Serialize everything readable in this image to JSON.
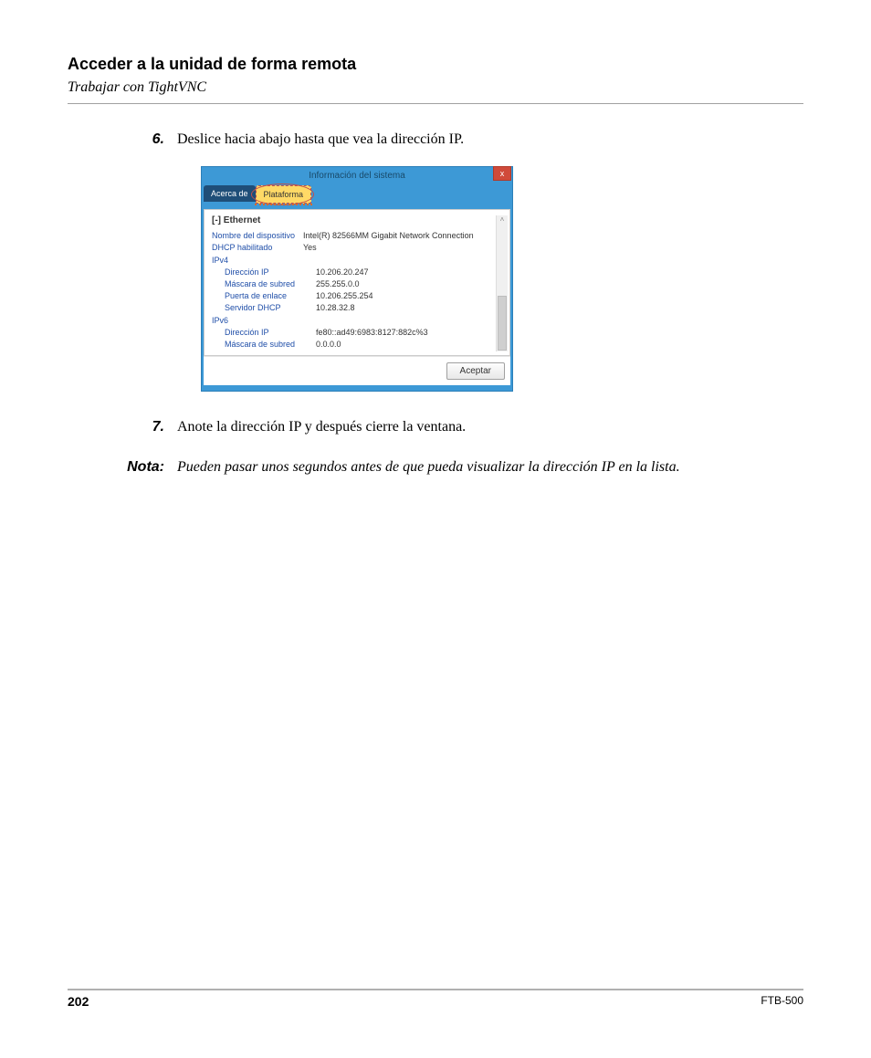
{
  "page": {
    "heading": "Acceder a la unidad de forma remota",
    "subheading": "Trabajar con TightVNC",
    "number": "202",
    "model": "FTB-500"
  },
  "steps": {
    "s6_num": "6.",
    "s6_text": "Deslice hacia abajo hasta que vea la dirección IP.",
    "s7_num": "7.",
    "s7_text": "Anote la dirección IP y después cierre la ventana."
  },
  "note": {
    "label": "Nota:",
    "text": "Pueden pasar unos segundos antes de que pueda visualizar la dirección IP en la lista."
  },
  "dialog": {
    "title": "Información del sistema",
    "close_glyph": "x",
    "tabs": {
      "about": "Acerca de",
      "platform": "Plataforma"
    },
    "section_header": "[-] Ethernet",
    "rows": {
      "device_name_k": "Nombre del dispositivo",
      "device_name_v": "Intel(R) 82566MM Gigabit Network Connection",
      "dhcp_enabled_k": "DHCP habilitado",
      "dhcp_enabled_v": "Yes",
      "ipv4": "IPv4",
      "ipv4_ip_k": "Dirección IP",
      "ipv4_ip_v": "10.206.20.247",
      "ipv4_mask_k": "Máscara de subred",
      "ipv4_mask_v": "255.255.0.0",
      "ipv4_gw_k": "Puerta de enlace",
      "ipv4_gw_v": "10.206.255.254",
      "ipv4_dhcp_k": "Servidor DHCP",
      "ipv4_dhcp_v": "10.28.32.8",
      "ipv6": "IPv6",
      "ipv6_ip_k": "Dirección IP",
      "ipv6_ip_v": "fe80::ad49:6983:8127:882c%3",
      "ipv6_mask_k": "Máscara de subred",
      "ipv6_mask_v": "0.0.0.0"
    },
    "scroll": {
      "up": "˄",
      "down": "˅"
    },
    "ok": "Aceptar"
  }
}
